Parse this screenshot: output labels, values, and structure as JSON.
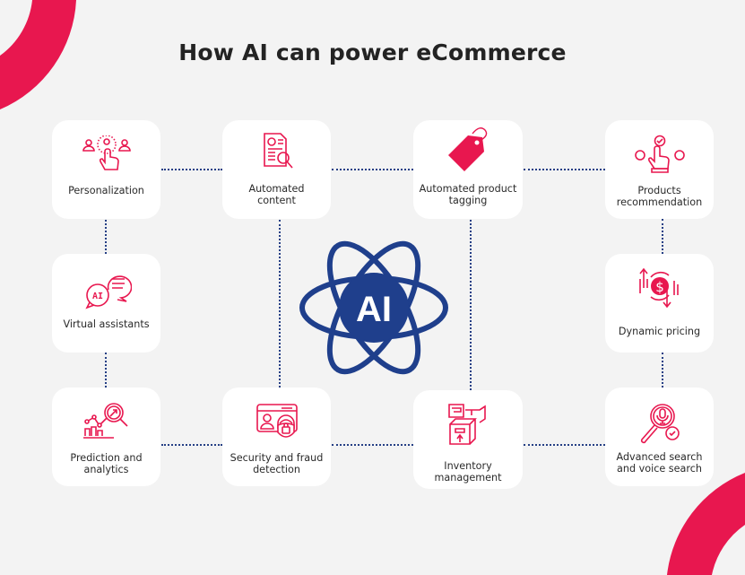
{
  "title": "How AI can power eCommerce",
  "colors": {
    "accent": "#e8174f",
    "navy": "#1f3f8c",
    "background": "#f3f3f3",
    "card": "#ffffff"
  },
  "center": {
    "label": "AI",
    "icon": "atom-icon"
  },
  "cards": [
    {
      "id": "personalization",
      "lines": [
        "Personalization"
      ],
      "icon": "personalization-hand-icon"
    },
    {
      "id": "automated-content",
      "lines": [
        "Automated",
        "content"
      ],
      "icon": "document-search-icon"
    },
    {
      "id": "automated-product-tagging",
      "lines": [
        "Automated product",
        "tagging"
      ],
      "icon": "price-tag-icon"
    },
    {
      "id": "products-recommendation",
      "lines": [
        "Products",
        "recommendation"
      ],
      "icon": "tap-select-icon"
    },
    {
      "id": "virtual-assistants",
      "lines": [
        "Virtual assistants"
      ],
      "icon": "chat-bubbles-ai-icon"
    },
    {
      "id": "dynamic-pricing",
      "lines": [
        "Dynamic pricing"
      ],
      "icon": "dollar-arrows-icon"
    },
    {
      "id": "prediction-and-analytics",
      "lines": [
        "Prediction and",
        "analytics"
      ],
      "icon": "chart-magnifier-icon"
    },
    {
      "id": "security-and-fraud-detection",
      "lines": [
        "Security and fraud",
        "detection"
      ],
      "icon": "id-lock-icon"
    },
    {
      "id": "inventory-management",
      "lines": [
        "Inventory",
        "management"
      ],
      "icon": "boxes-icon"
    },
    {
      "id": "advanced-search-voice-search",
      "lines": [
        "Advanced search",
        "and voice search"
      ],
      "icon": "voice-search-icon"
    }
  ]
}
